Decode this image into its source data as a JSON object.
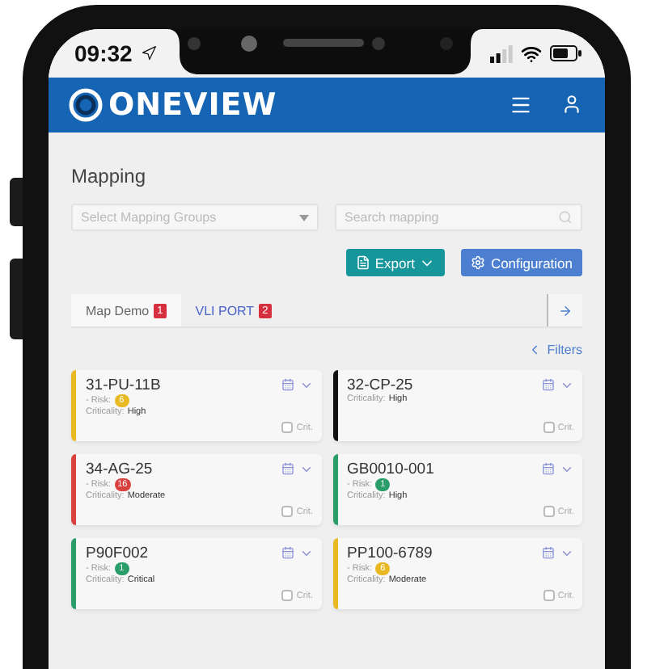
{
  "status_bar": {
    "time": "09:32"
  },
  "header": {
    "logo": "ONEVIEW"
  },
  "page": {
    "title": "Mapping"
  },
  "group_select": {
    "placeholder": "Select Mapping Groups"
  },
  "search": {
    "placeholder": "Search mapping"
  },
  "actions": [
    {
      "label": "Export",
      "kind": "export"
    },
    {
      "label": "Configuration",
      "kind": "config"
    }
  ],
  "tabs": [
    {
      "label": "Map Demo",
      "count": "1",
      "selected": true
    },
    {
      "label": "VLI PORT",
      "count": "2",
      "selected": false
    }
  ],
  "filters_link": "Filters",
  "cards": [
    {
      "title": "31-PU-11B",
      "risk_label": "- Risk:",
      "risk": "6",
      "criticality_label": "Criticality:",
      "criticality": "High",
      "color": "#e8b923",
      "check_label": "Crit.",
      "checked": false
    },
    {
      "title": "32-CP-25",
      "criticality_label": "Criticality:",
      "criticality": "High",
      "color": "#111111",
      "check_label": "Crit.",
      "checked": false
    },
    {
      "title": "34-AG-25",
      "risk_label": "- Risk:",
      "risk": "16",
      "criticality_label": "Criticality:",
      "criticality": "Moderate",
      "color": "#d9413f",
      "check_label": "Crit.",
      "checked": false
    },
    {
      "title": "GB0010-001",
      "risk_label": "- Risk:",
      "risk": "1",
      "criticality_label": "Criticality:",
      "criticality": "High",
      "color": "#2a9d6a",
      "check_label": "Crit.",
      "checked": false
    },
    {
      "title": "P90F002",
      "risk_label": "- Risk:",
      "risk": "1",
      "criticality_label": "Criticality:",
      "criticality": "Critical",
      "color": "#2a9d6a",
      "check_label": "Crit.",
      "checked": false
    },
    {
      "title": "PP100-6789",
      "risk_label": "- Risk:",
      "risk": "6",
      "criticality_label": "Criticality:",
      "criticality": "Moderate",
      "color": "#e8b923",
      "check_label": "Crit.",
      "checked": false
    }
  ]
}
